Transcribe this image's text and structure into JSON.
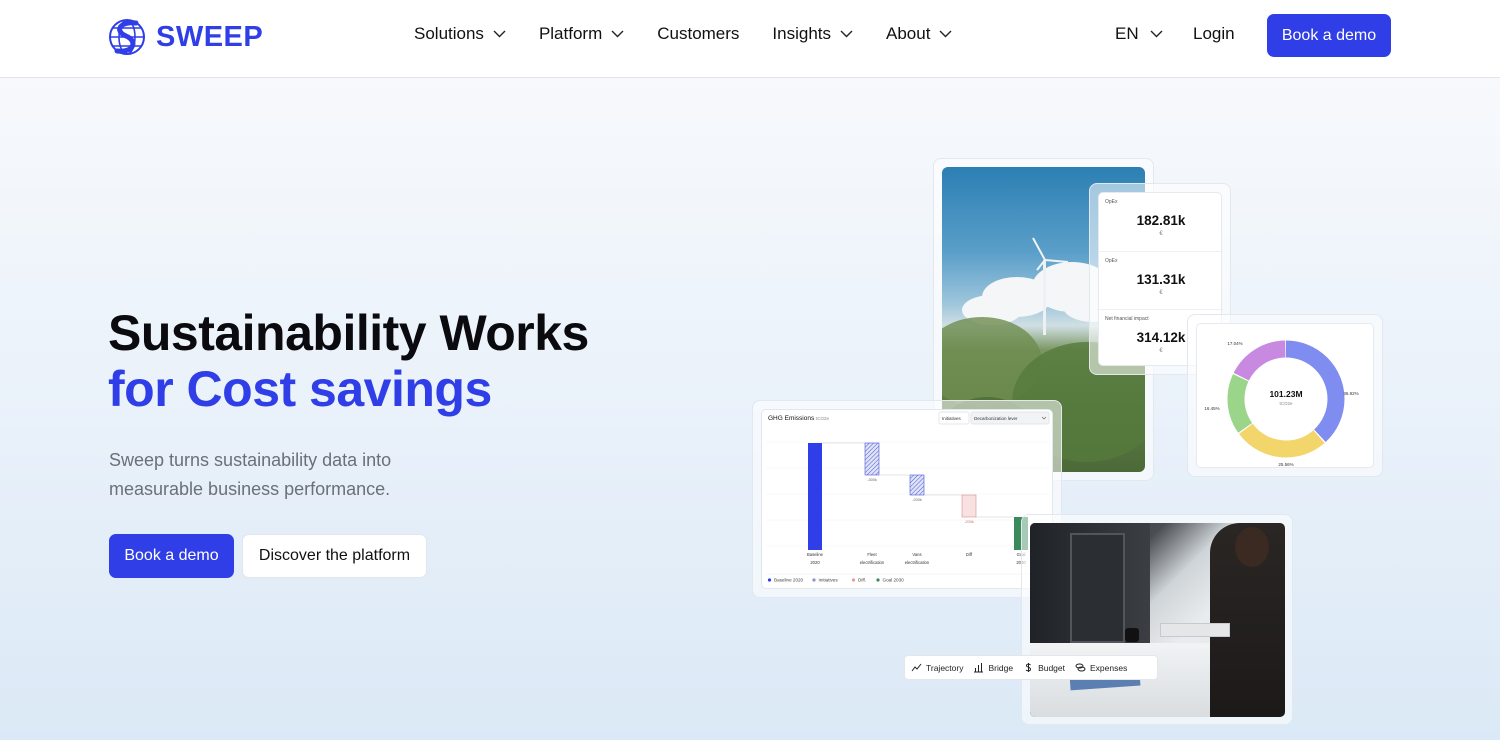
{
  "brand": {
    "name": "SWEEP",
    "accent": "#2f3ee6"
  },
  "nav": {
    "items": [
      {
        "label": "Solutions",
        "dropdown": true
      },
      {
        "label": "Platform",
        "dropdown": true
      },
      {
        "label": "Customers",
        "dropdown": false
      },
      {
        "label": "Insights",
        "dropdown": true
      },
      {
        "label": "About",
        "dropdown": true
      }
    ],
    "lang": "EN",
    "login": "Login",
    "cta": "Book a demo"
  },
  "hero": {
    "title_line1": "Sustainability Works",
    "title_line2": "for Cost savings",
    "subtitle": "Sweep turns sustainability data into measurable business performance.",
    "primary_cta": "Book a demo",
    "secondary_cta": "Discover the platform"
  },
  "kpis": [
    {
      "label": "OpEx",
      "value": "182.81k",
      "unit": "€"
    },
    {
      "label": "OpEx",
      "value": "131.31k",
      "unit": "€"
    },
    {
      "label": "Net financial impact",
      "value": "314.12k",
      "unit": "€"
    }
  ],
  "donut": {
    "center_value": "101.23M",
    "center_unit": "tCO2e",
    "segments": [
      {
        "label": "36.92%",
        "value": 36.92,
        "color": "#7f8cf0"
      },
      {
        "label": "25.56%",
        "value": 25.56,
        "color": "#f2d66b"
      },
      {
        "label": "16.45%",
        "value": 16.45,
        "color": "#9bd58a"
      },
      {
        "label": "17.04%",
        "value": 17.04,
        "color": "#c88ae0"
      }
    ]
  },
  "ghg": {
    "title": "GHG Emissions",
    "unit": "tCO2e",
    "filter_label": "Initiatives",
    "filter_value": "Decarbonization lever",
    "bars": [
      {
        "label1": "Baseline",
        "label2": "2020",
        "note": ""
      },
      {
        "label1": "Fleet",
        "label2": "electrification",
        "note": "-300k"
      },
      {
        "label1": "Vans",
        "label2": "electrification",
        "note": "-200k"
      },
      {
        "label1": "Diff",
        "label2": "",
        "note": "-200k"
      },
      {
        "label1": "Goal",
        "label2": "2030",
        "note": ""
      }
    ],
    "legend": [
      {
        "label": "Baseline 2020",
        "color": "#2f3ee6"
      },
      {
        "label": "Initiatives",
        "color": "#8b95c9"
      },
      {
        "label": "Diff.",
        "color": "#e89a9a"
      },
      {
        "label": "Goal 2030",
        "color": "#3a8a5c"
      }
    ]
  },
  "tabs": [
    {
      "label": "Trajectory",
      "icon": "trajectory-icon"
    },
    {
      "label": "Bridge",
      "icon": "bar-chart-icon"
    },
    {
      "label": "Budget",
      "icon": "dollar-icon"
    },
    {
      "label": "Expenses",
      "icon": "coins-icon"
    }
  ]
}
